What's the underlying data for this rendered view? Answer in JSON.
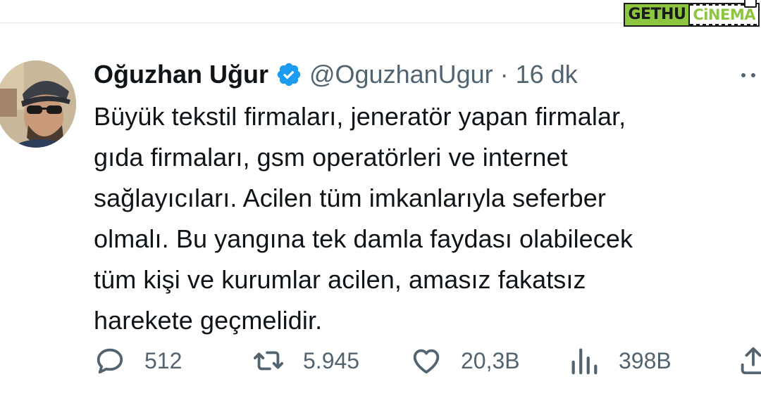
{
  "watermark": {
    "left": "GETHU",
    "right": "CiNEMA"
  },
  "tweet": {
    "name": "Oğuzhan Uğur",
    "handle_time": "@OguzhanUgur · 16 dk",
    "text": "Büyük tekstil firmaları, jeneratör yapan firmalar,\ngıda firmaları, gsm operatörleri ve internet\nsağlayıcıları. Acilen tüm imkanlarıyla seferber\nolmalı. Bu yangına tek damla faydası olabilecek\ntüm kişi ve kurumlar acilen, amasız fakatsız\nharekete geçmelidir."
  },
  "actions": {
    "replies": "512",
    "retweets": "5.945",
    "likes": "20,3B",
    "views": "398B"
  },
  "icons": [
    "reply-icon",
    "retweet-icon",
    "like-icon",
    "views-icon",
    "share-icon",
    "more-icon",
    "verified-icon"
  ],
  "colors": {
    "verified": "#1d9bf0",
    "secondary_text": "#536471",
    "watermark_green": "#8cc63f"
  }
}
